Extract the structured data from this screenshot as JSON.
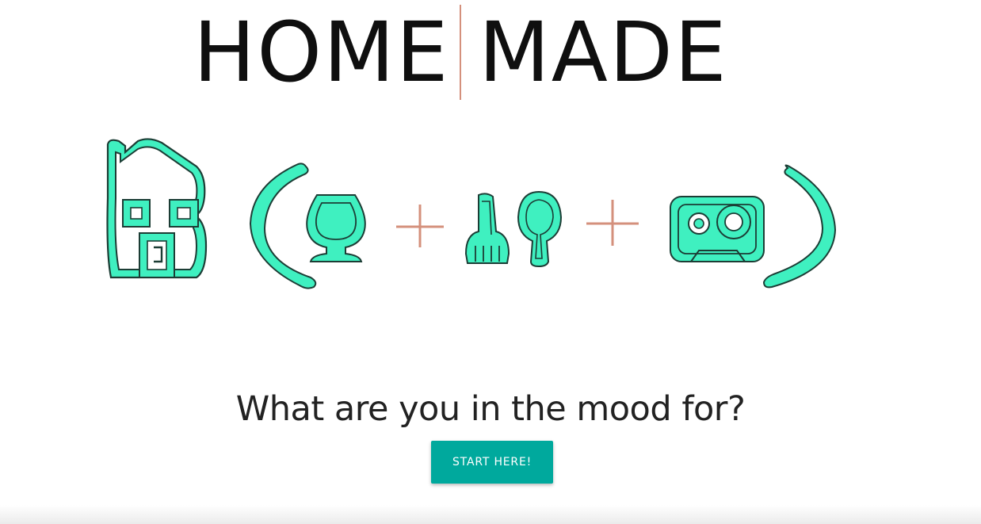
{
  "logo": {
    "left_word": "HOME",
    "right_word": "MADE",
    "divider_color": "#d4907c"
  },
  "illustration": {
    "icons": [
      "house-icon",
      "wine-glass-icon",
      "fork-icon",
      "spoon-icon",
      "cassette-tape-icon"
    ],
    "operators": [
      "plus-icon",
      "plus-icon"
    ],
    "fill_color": "#3ff0c0",
    "accent_color": "#d4907c"
  },
  "hero": {
    "prompt": "What are you in the mood for?",
    "button_label": "START HERE!",
    "button_color": "#00a99d"
  }
}
